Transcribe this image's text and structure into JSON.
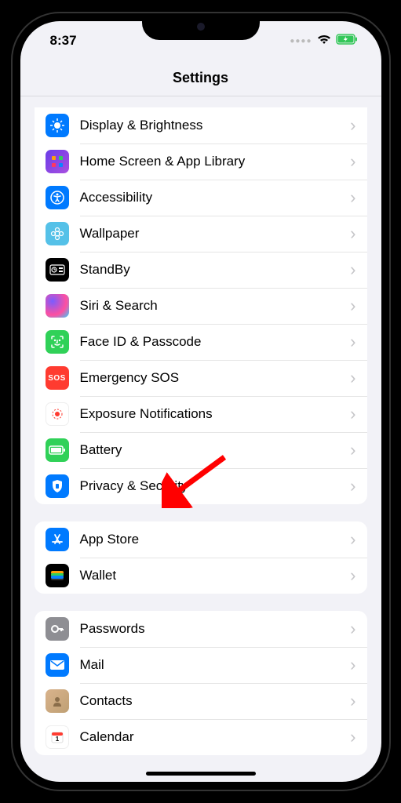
{
  "status": {
    "time": "8:37"
  },
  "header": {
    "title": "Settings"
  },
  "groups": [
    {
      "id": "general",
      "rows": [
        {
          "id": "display",
          "label": "Display & Brightness"
        },
        {
          "id": "home",
          "label": "Home Screen & App Library"
        },
        {
          "id": "access",
          "label": "Accessibility"
        },
        {
          "id": "wallpaper",
          "label": "Wallpaper"
        },
        {
          "id": "standby",
          "label": "StandBy"
        },
        {
          "id": "siri",
          "label": "Siri & Search"
        },
        {
          "id": "faceid",
          "label": "Face ID & Passcode"
        },
        {
          "id": "sos",
          "label": "Emergency SOS"
        },
        {
          "id": "exposure",
          "label": "Exposure Notifications"
        },
        {
          "id": "battery",
          "label": "Battery"
        },
        {
          "id": "privacy",
          "label": "Privacy & Security"
        }
      ]
    },
    {
      "id": "store",
      "rows": [
        {
          "id": "appstore",
          "label": "App Store"
        },
        {
          "id": "wallet",
          "label": "Wallet"
        }
      ]
    },
    {
      "id": "accounts",
      "rows": [
        {
          "id": "passwords",
          "label": "Passwords"
        },
        {
          "id": "mail",
          "label": "Mail"
        },
        {
          "id": "contacts",
          "label": "Contacts"
        },
        {
          "id": "calendar",
          "label": "Calendar"
        }
      ]
    }
  ],
  "annotation": {
    "target": "battery"
  }
}
